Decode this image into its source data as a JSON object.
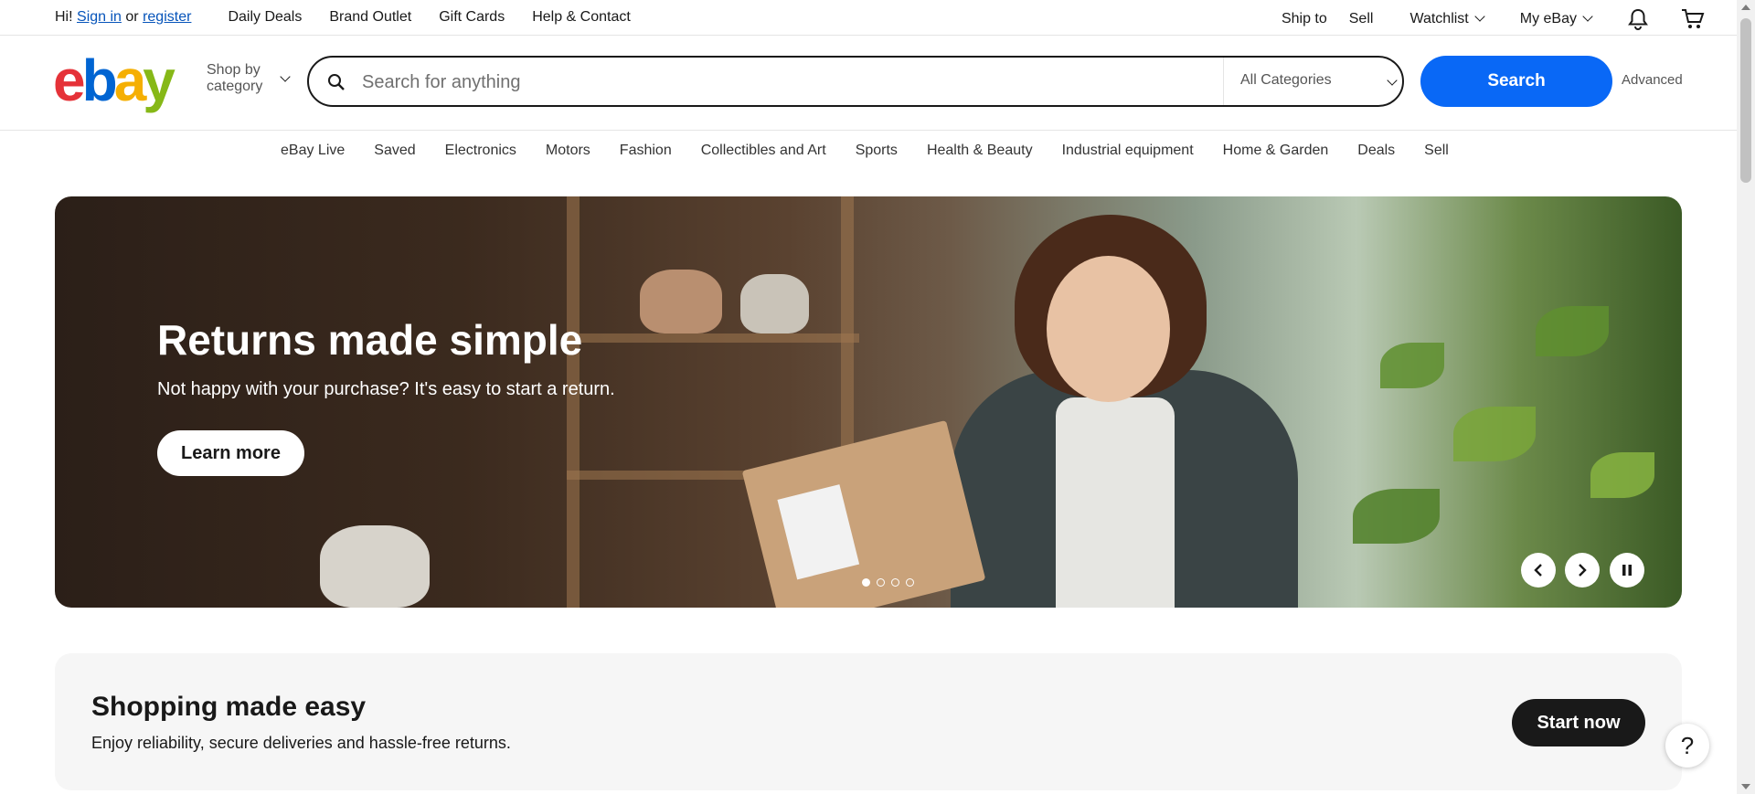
{
  "topbar": {
    "greeting_prefix": "Hi!",
    "sign_in": "Sign in",
    "or": "or",
    "register": "register",
    "links": [
      "Daily Deals",
      "Brand Outlet",
      "Gift Cards",
      "Help & Contact"
    ],
    "ship_to": "Ship to",
    "sell": "Sell",
    "watchlist": "Watchlist",
    "my_ebay": "My eBay",
    "icons": [
      "bell-icon",
      "cart-icon"
    ]
  },
  "header": {
    "logo": {
      "e": "e",
      "b": "b",
      "a": "a",
      "y": "y"
    },
    "shop_by_line1": "Shop by",
    "shop_by_line2": "category",
    "search_placeholder": "Search for anything",
    "category_select": "All Categories",
    "search_button": "Search",
    "advanced": "Advanced"
  },
  "nav": {
    "items": [
      "eBay Live",
      "Saved",
      "Electronics",
      "Motors",
      "Fashion",
      "Collectibles and Art",
      "Sports",
      "Health & Beauty",
      "Industrial equipment",
      "Home & Garden",
      "Deals",
      "Sell"
    ]
  },
  "hero": {
    "title": "Returns made simple",
    "subtitle": "Not happy with your purchase? It's easy to start a return.",
    "cta": "Learn more",
    "slides_total": 4,
    "active_slide": 1
  },
  "banner": {
    "title": "Shopping made easy",
    "subtitle": "Enjoy reliability, secure deliveries and hassle-free returns.",
    "cta": "Start now"
  },
  "help_button": "?",
  "colors": {
    "accent_blue": "#0968f6",
    "link_blue": "#0654ba",
    "logo_red": "#e53238",
    "logo_blue": "#0064d2",
    "logo_yellow": "#f5af02",
    "logo_green": "#86b817"
  }
}
